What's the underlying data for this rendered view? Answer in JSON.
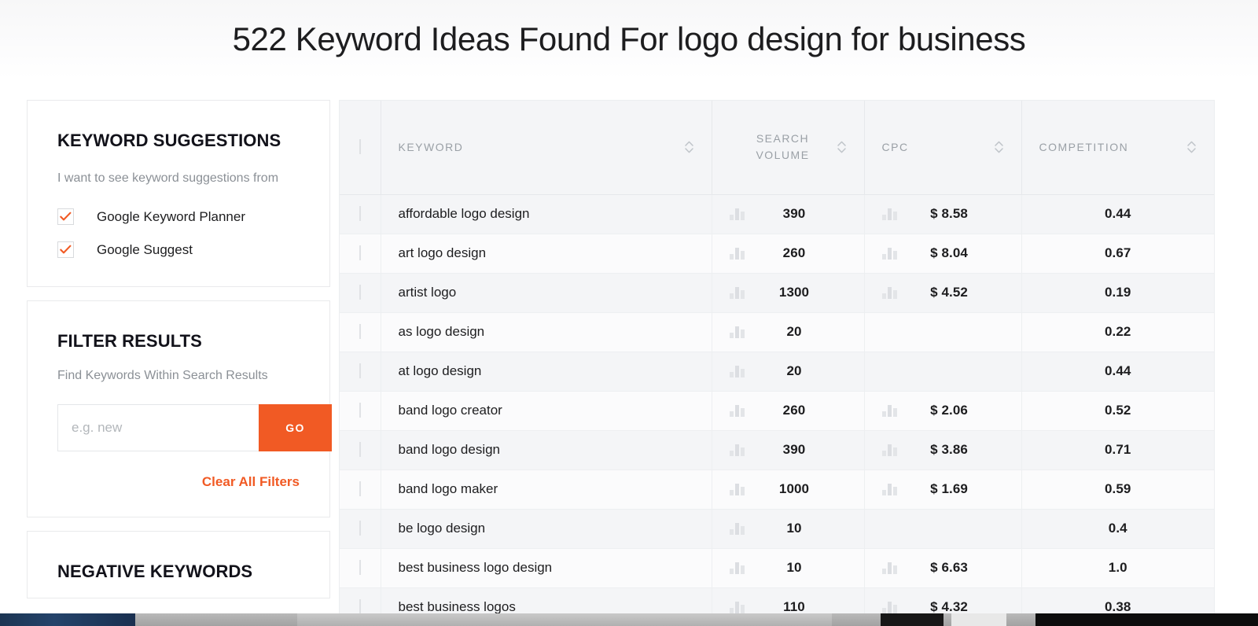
{
  "header": {
    "title": "522 Keyword Ideas Found For logo design for business"
  },
  "sidebar": {
    "suggestions_panel": {
      "title": "KEYWORD SUGGESTIONS",
      "subtitle": "I want to see keyword suggestions from",
      "options": [
        {
          "label": "Google Keyword Planner",
          "checked": true
        },
        {
          "label": "Google Suggest",
          "checked": true
        }
      ]
    },
    "filter_panel": {
      "title": "FILTER RESULTS",
      "subtitle": "Find Keywords Within Search Results",
      "input_value": "",
      "input_placeholder": "e.g. new",
      "go_label": "GO",
      "clear_label": "Clear All Filters"
    },
    "negative_panel": {
      "title": "NEGATIVE KEYWORDS"
    }
  },
  "table": {
    "columns": [
      {
        "key": "checkbox",
        "label": "",
        "sortable": false
      },
      {
        "key": "keyword",
        "label": "KEYWORD",
        "sortable": true
      },
      {
        "key": "search_volume",
        "label": "SEARCH VOLUME",
        "sortable": true
      },
      {
        "key": "cpc",
        "label": "CPC",
        "sortable": true
      },
      {
        "key": "competition",
        "label": "COMPETITION",
        "sortable": true
      }
    ],
    "rows": [
      {
        "keyword": "affordable logo design",
        "search_volume": "390",
        "cpc": "$ 8.58",
        "competition": "0.44"
      },
      {
        "keyword": "art logo design",
        "search_volume": "260",
        "cpc": "$ 8.04",
        "competition": "0.67"
      },
      {
        "keyword": "artist logo",
        "search_volume": "1300",
        "cpc": "$ 4.52",
        "competition": "0.19"
      },
      {
        "keyword": "as logo design",
        "search_volume": "20",
        "cpc": "",
        "competition": "0.22"
      },
      {
        "keyword": "at logo design",
        "search_volume": "20",
        "cpc": "",
        "competition": "0.44"
      },
      {
        "keyword": "band logo creator",
        "search_volume": "260",
        "cpc": "$ 2.06",
        "competition": "0.52"
      },
      {
        "keyword": "band logo design",
        "search_volume": "390",
        "cpc": "$ 3.86",
        "competition": "0.71"
      },
      {
        "keyword": "band logo maker",
        "search_volume": "1000",
        "cpc": "$ 1.69",
        "competition": "0.59"
      },
      {
        "keyword": "be logo design",
        "search_volume": "10",
        "cpc": "",
        "competition": "0.4"
      },
      {
        "keyword": "best business logo design",
        "search_volume": "10",
        "cpc": "$ 6.63",
        "competition": "1.0"
      },
      {
        "keyword": "best business logos",
        "search_volume": "110",
        "cpc": "$ 4.32",
        "competition": "0.38"
      }
    ]
  },
  "colors": {
    "accent": "#f15a24",
    "text": "#1d1d1f",
    "muted": "#8b9096",
    "header_label": "#9aa0a6",
    "row_odd": "#f4f5f7",
    "row_even": "#fbfbfc",
    "border": "#e9eaec"
  }
}
